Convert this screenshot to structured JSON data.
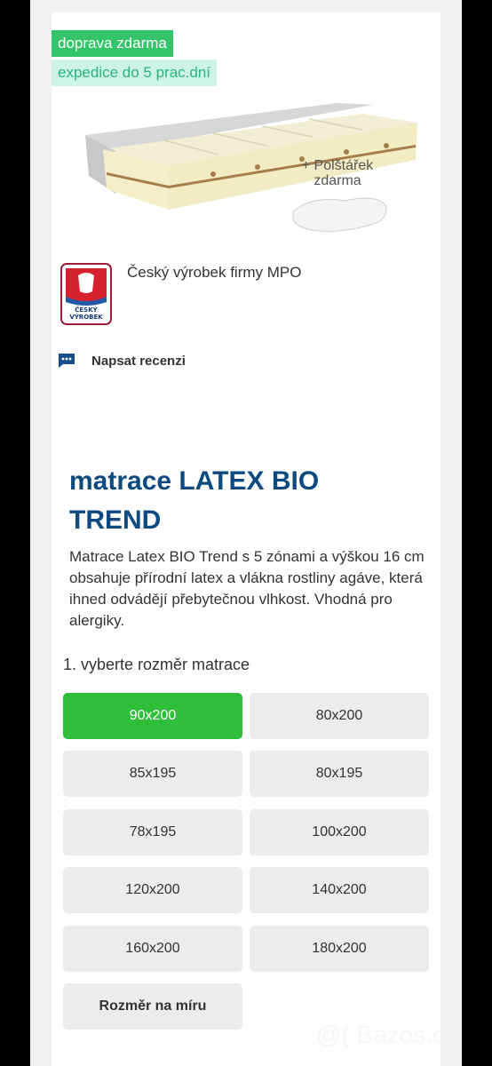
{
  "badges": {
    "shipping": "doprava zdarma",
    "dispatch": "expedice do 5 prac.dní"
  },
  "promo": {
    "line1": "+ Polštářek",
    "line2": "zdarma"
  },
  "origin": {
    "text": "Český výrobek firmy MPO",
    "logo_text": "ČESKÝ VÝROBEK"
  },
  "review": {
    "label": "Napsat recenzi"
  },
  "product": {
    "title": "matrace LATEX BIO TREND",
    "description": "Matrace Latex BIO Trend s 5 zónami a výškou 16 cm obsahuje přírodní latex a vlákna rostliny agáve, která ihned odvádějí přebytečnou vlhkost. Vhodná pro alergiky."
  },
  "size_selector": {
    "label": "1. vyberte rozměr matrace",
    "options": [
      "90x200",
      "80x200",
      "85x195",
      "80x195",
      "78x195",
      "100x200",
      "120x200",
      "140x200",
      "160x200",
      "180x200",
      "Rozměr na míru"
    ],
    "selected": "90x200"
  },
  "colors": {
    "accent_green": "#2fbe39",
    "title_blue": "#0d4a80",
    "badge_mint": "#cdf3e8"
  },
  "watermark": "@( Bazos.cz"
}
